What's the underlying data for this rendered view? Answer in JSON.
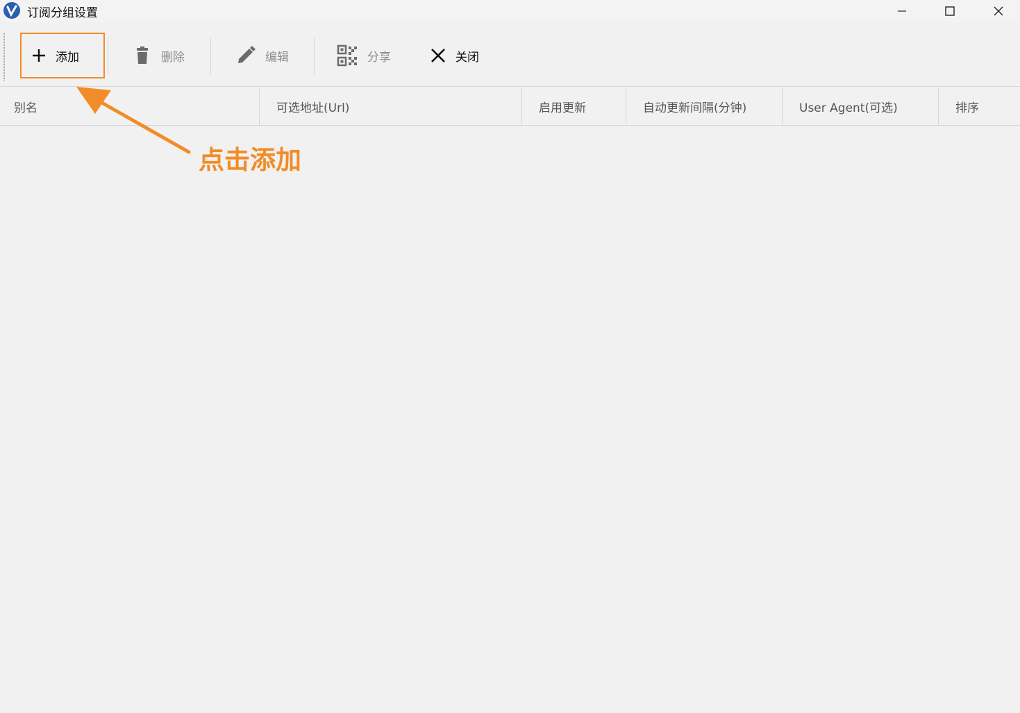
{
  "window": {
    "title": "订阅分组设置",
    "logo_icon": "v2rayn-logo-icon",
    "controls": [
      "minimize-icon",
      "maximize-icon",
      "close-icon"
    ]
  },
  "toolbar": {
    "add_label": "添加",
    "delete_label": "删除",
    "edit_label": "编辑",
    "share_label": "分享",
    "close_label": "关闭"
  },
  "grid": {
    "columns": [
      "别名",
      "可选地址(Url)",
      "启用更新",
      "自动更新间隔(分钟)",
      "User Agent(可选)",
      "排序"
    ],
    "rows": []
  },
  "annotation": {
    "text": "点击添加",
    "color": "#f28c28"
  },
  "colors": {
    "accent": "#f28c28",
    "background": "#f1f1f1",
    "disabled_text": "#8e8e8e"
  }
}
